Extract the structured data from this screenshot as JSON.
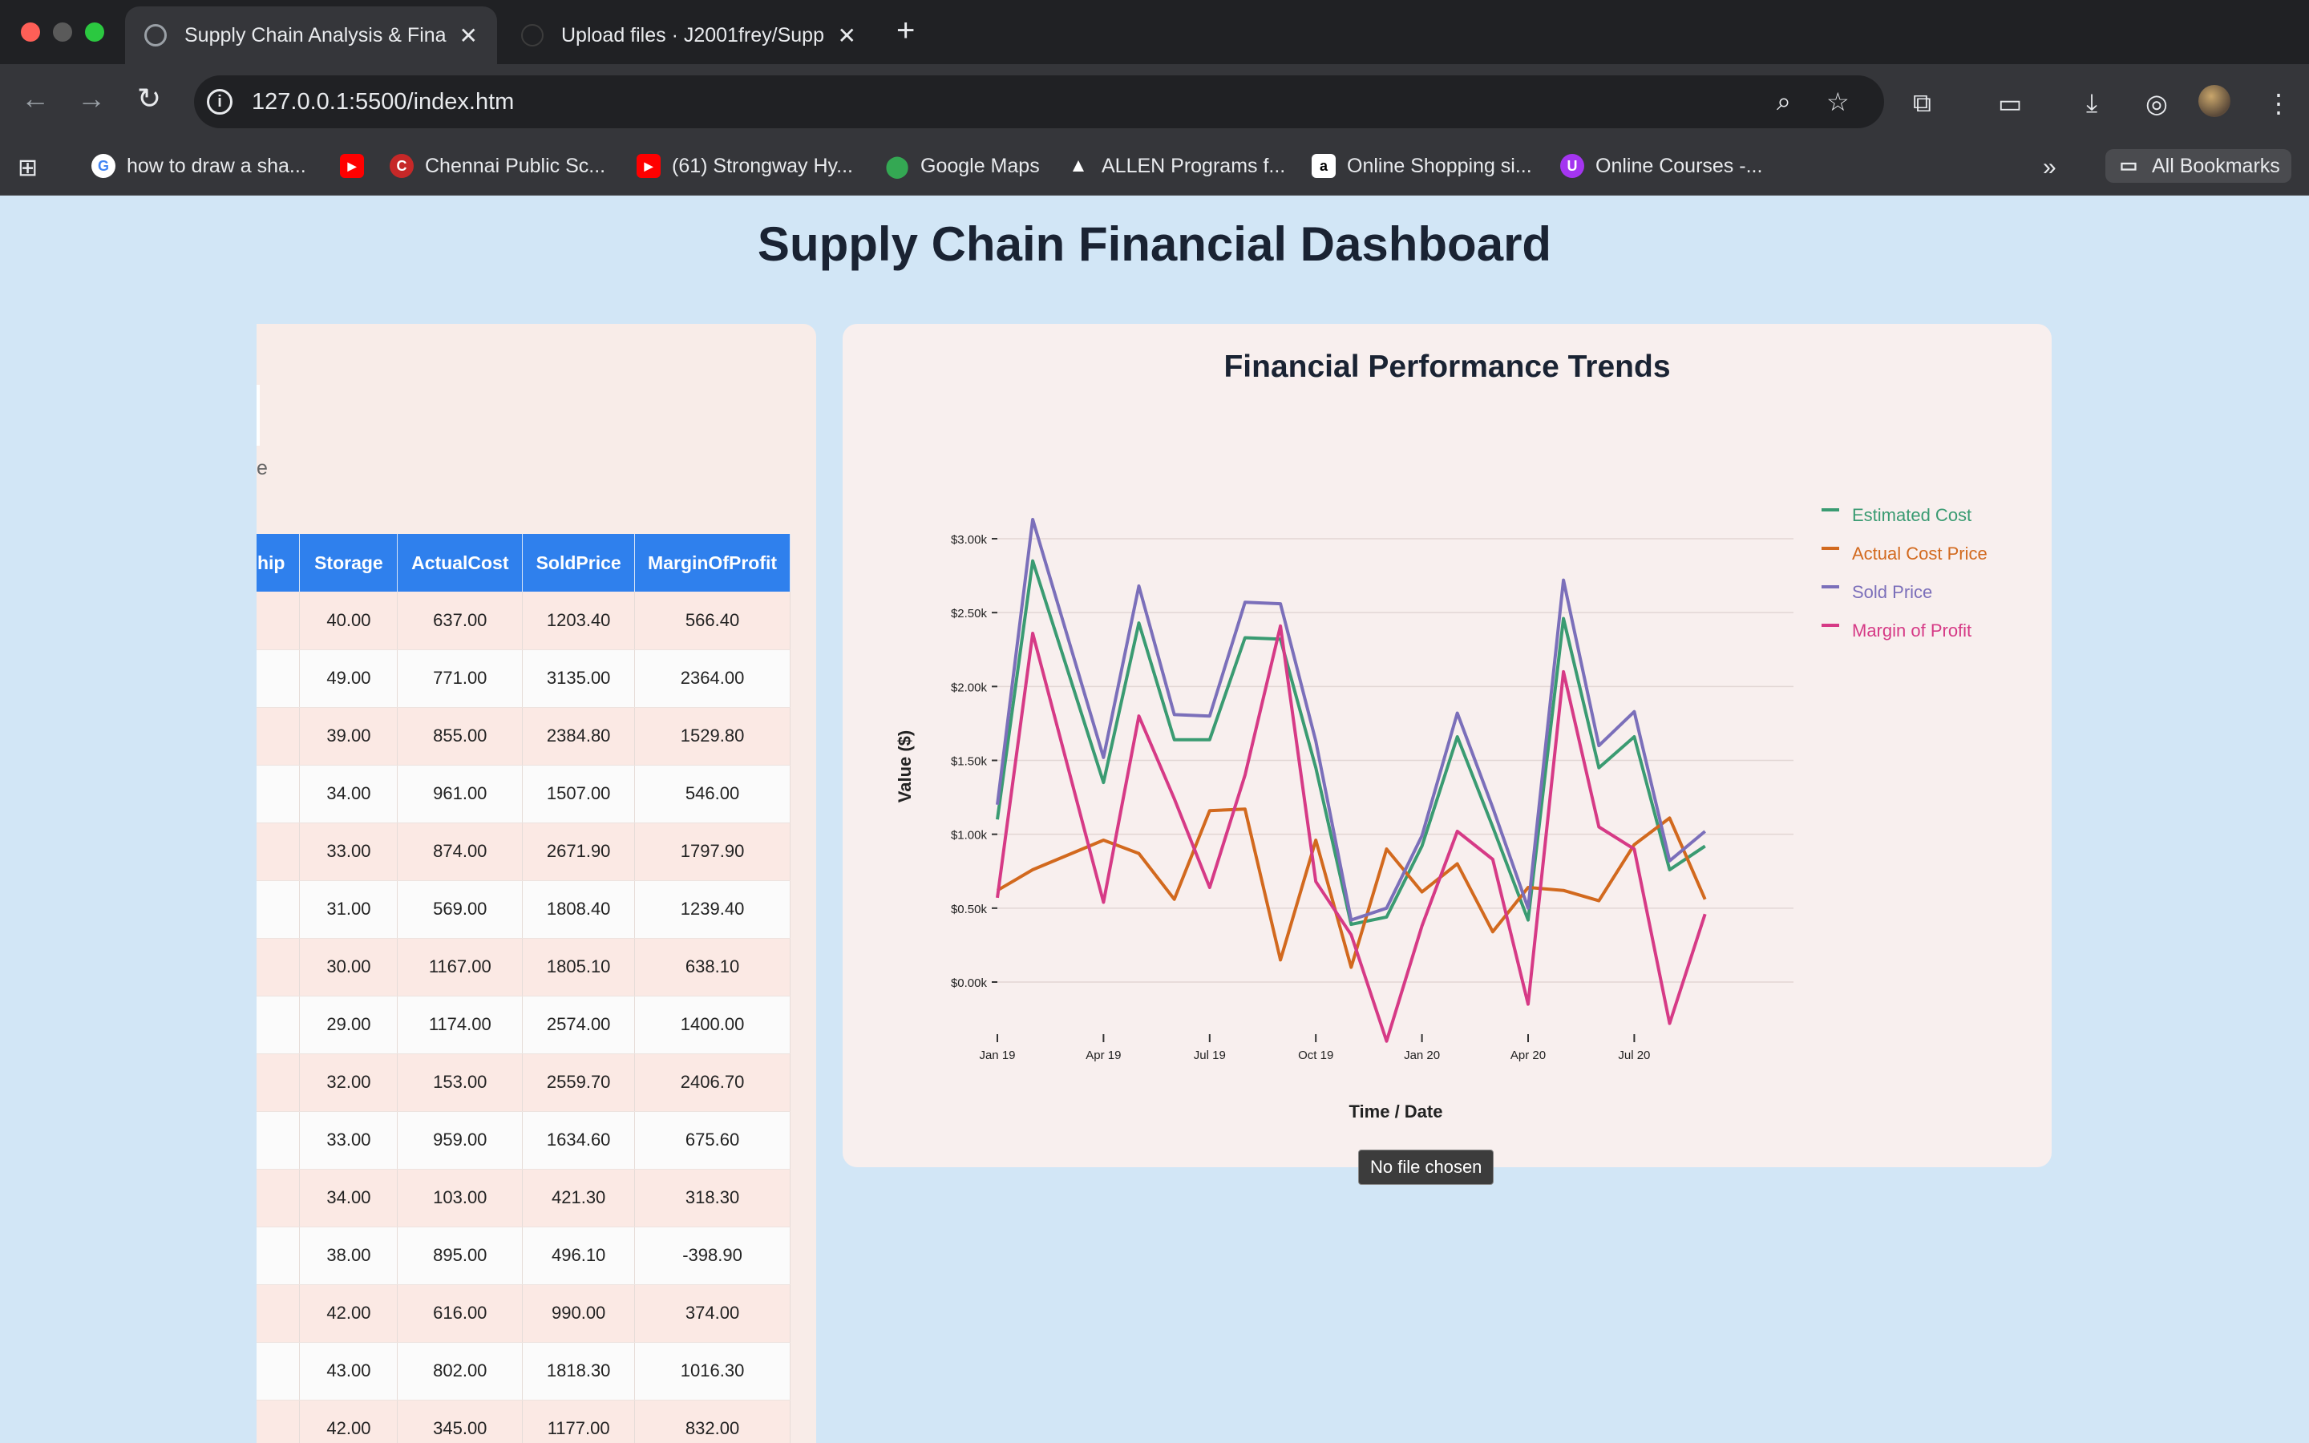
{
  "browser": {
    "tabs": [
      {
        "title": "Supply Chain Analysis & Finan",
        "active": true
      },
      {
        "title": "Upload files · J2001frey/Supp",
        "active": false
      }
    ],
    "url": "127.0.0.1:5500/index.htm",
    "bookmarks": [
      {
        "label": "how to draw a sha...",
        "icon": "google-icon"
      },
      {
        "label": "",
        "icon": "youtube-icon"
      },
      {
        "label": "Chennai Public Sc...",
        "icon": "school-icon"
      },
      {
        "label": "(61) Strongway Hy...",
        "icon": "youtube-icon"
      },
      {
        "label": "Google Maps",
        "icon": "maps-icon"
      },
      {
        "label": "ALLEN Programs f...",
        "icon": "allen-icon"
      },
      {
        "label": "Online Shopping si...",
        "icon": "amazon-icon"
      },
      {
        "label": "Online Courses -...",
        "icon": "udemy-icon"
      }
    ],
    "all_bookmarks_label": "All Bookmarks"
  },
  "page": {
    "title": "Supply Chain Financial Dashboard",
    "left_fragment": "e",
    "tooltip": "No file chosen"
  },
  "table": {
    "headers": [
      "hip",
      "Storage",
      "ActualCost",
      "SoldPrice",
      "MarginOfProfit"
    ],
    "rows": [
      [
        "",
        "40.00",
        "637.00",
        "1203.40",
        "566.40"
      ],
      [
        "",
        "49.00",
        "771.00",
        "3135.00",
        "2364.00"
      ],
      [
        "",
        "39.00",
        "855.00",
        "2384.80",
        "1529.80"
      ],
      [
        "",
        "34.00",
        "961.00",
        "1507.00",
        "546.00"
      ],
      [
        "",
        "33.00",
        "874.00",
        "2671.90",
        "1797.90"
      ],
      [
        "",
        "31.00",
        "569.00",
        "1808.40",
        "1239.40"
      ],
      [
        "",
        "30.00",
        "1167.00",
        "1805.10",
        "638.10"
      ],
      [
        "",
        "29.00",
        "1174.00",
        "2574.00",
        "1400.00"
      ],
      [
        "",
        "32.00",
        "153.00",
        "2559.70",
        "2406.70"
      ],
      [
        "",
        "33.00",
        "959.00",
        "1634.60",
        "675.60"
      ],
      [
        "",
        "34.00",
        "103.00",
        "421.30",
        "318.30"
      ],
      [
        "",
        "38.00",
        "895.00",
        "496.10",
        "-398.90"
      ],
      [
        "",
        "42.00",
        "616.00",
        "990.00",
        "374.00"
      ],
      [
        "",
        "43.00",
        "802.00",
        "1818.30",
        "1016.30"
      ],
      [
        "",
        "42.00",
        "345.00",
        "1177.00",
        "832.00"
      ]
    ]
  },
  "chart_data": {
    "type": "line",
    "title": "Financial Performance Trends",
    "xlabel": "Time / Date",
    "ylabel": "Value ($)",
    "ylim": [
      -400,
      3200
    ],
    "yticks": [
      0,
      500,
      1000,
      1500,
      2000,
      2500,
      3000
    ],
    "ytick_labels": [
      "$0.00k",
      "$0.50k",
      "$1.00k",
      "$1.50k",
      "$2.00k",
      "$2.50k",
      "$3.00k"
    ],
    "xlim": [
      0,
      22.5
    ],
    "xticks": [
      0,
      3,
      6,
      9,
      12,
      15,
      18
    ],
    "xtick_labels": [
      "Jan 19",
      "Apr 19",
      "Jul 19",
      "Oct 19",
      "Jan 20",
      "Apr 20",
      "Jul 20"
    ],
    "legend": "top-right",
    "grid": "horizontal",
    "x": [
      0,
      1,
      3,
      4,
      5,
      6,
      7,
      8,
      9,
      10,
      11,
      12,
      13,
      14,
      15,
      16,
      17,
      18,
      19,
      20,
      21,
      22,
      22.5
    ],
    "series": [
      {
        "name": "Estimated Cost",
        "color": "#3a9b72",
        "values": [
          1100,
          2850,
          1350,
          2430,
          1640,
          1640,
          2330,
          2320,
          1450,
          390,
          440,
          920,
          1660,
          1050,
          420,
          2460,
          1450,
          1660,
          760,
          920
        ]
      },
      {
        "name": "Actual Cost Price",
        "color": "#d2691e",
        "values": [
          620,
          760,
          960,
          870,
          560,
          1160,
          1170,
          150,
          960,
          100,
          900,
          610,
          800,
          340,
          640,
          620,
          550,
          930,
          1110,
          560
        ]
      },
      {
        "name": "Sold Price",
        "color": "#7b6fba",
        "values": [
          1200,
          3130,
          1520,
          2680,
          1810,
          1800,
          2570,
          2560,
          1630,
          420,
          500,
          990,
          1820,
          1180,
          500,
          2720,
          1600,
          1830,
          820,
          1020
        ]
      },
      {
        "name": "Margin of Profit",
        "color": "#d63a86",
        "values": [
          570,
          2360,
          540,
          1800,
          1240,
          640,
          1400,
          2410,
          680,
          320,
          -400,
          380,
          1020,
          830,
          -150,
          2100,
          1050,
          900,
          -280,
          460
        ]
      }
    ]
  }
}
